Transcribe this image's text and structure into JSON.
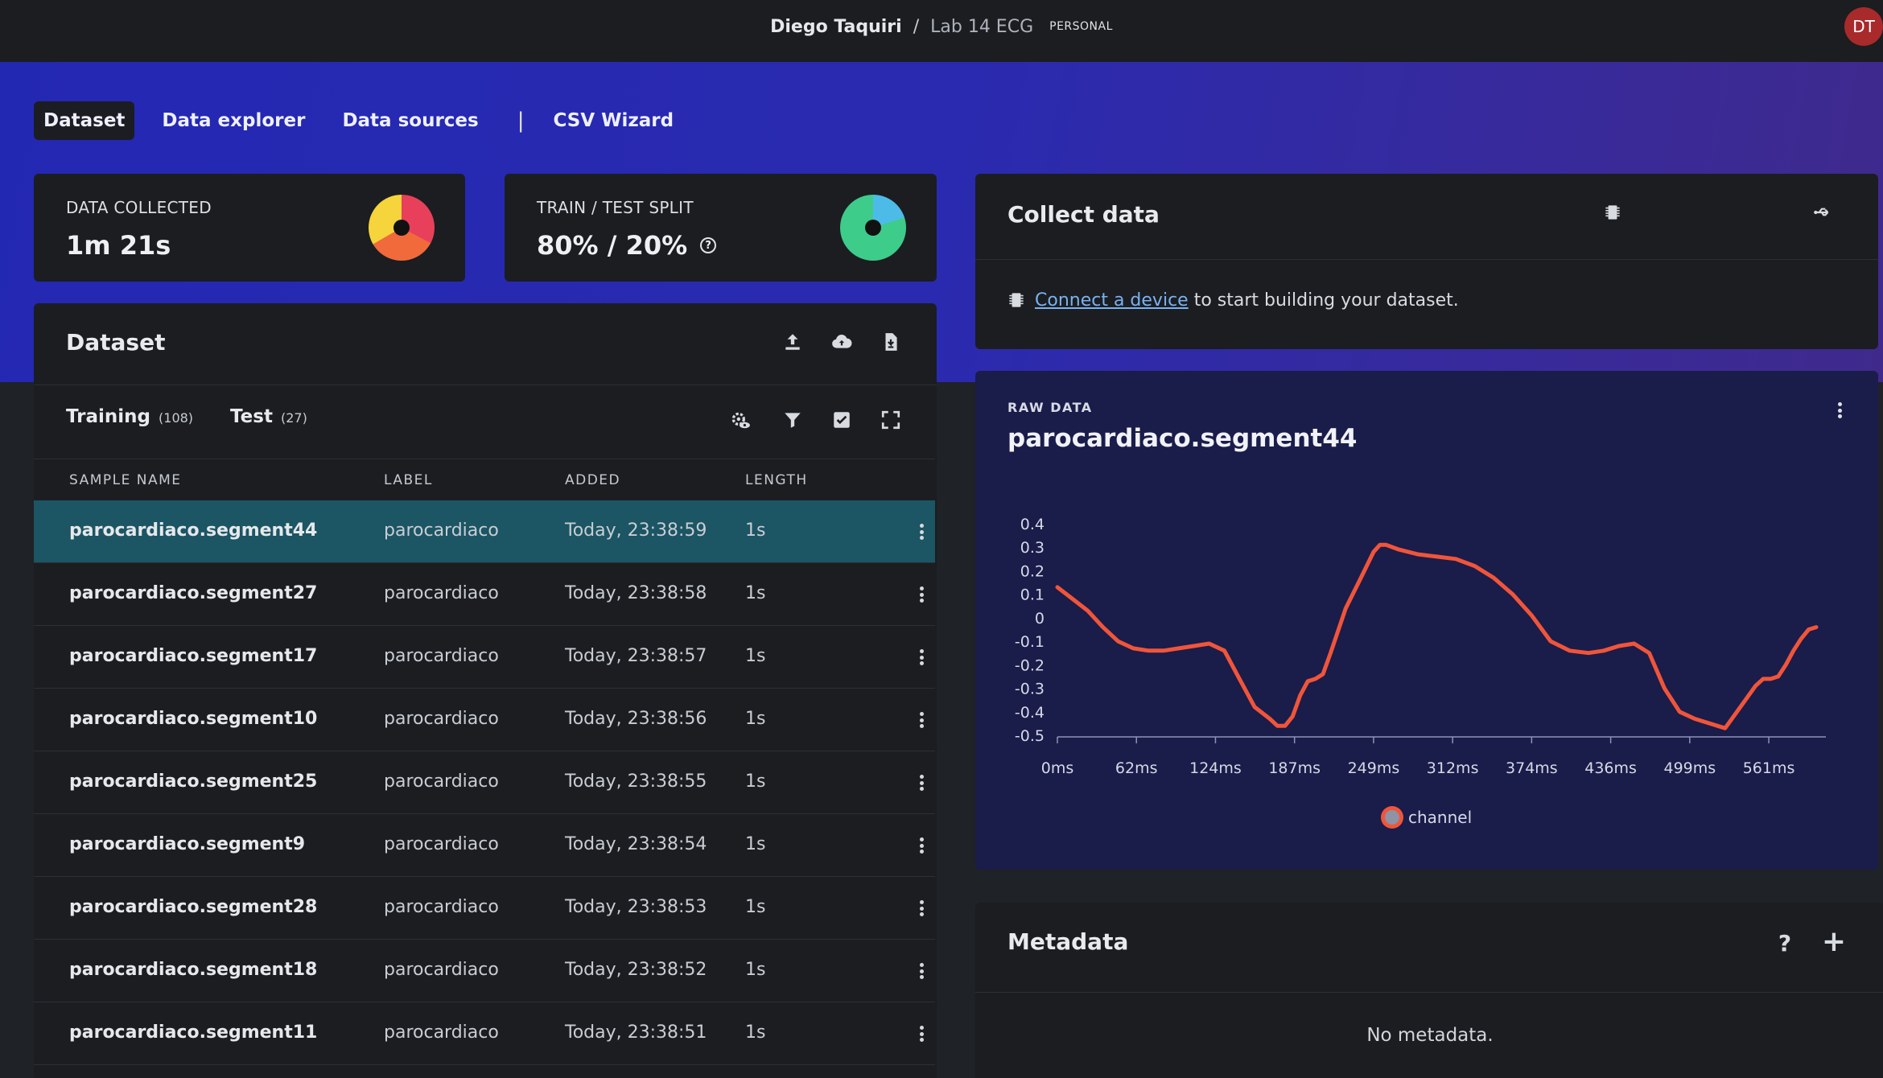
{
  "header": {
    "org": "Diego Taquiri",
    "separator": "/",
    "project": "Lab 14 ECG",
    "tag": "PERSONAL",
    "avatar_initials": "DT"
  },
  "nav": {
    "tabs": [
      {
        "label": "Dataset",
        "active": true
      },
      {
        "label": "Data explorer",
        "active": false
      },
      {
        "label": "Data sources",
        "active": false
      }
    ],
    "divider": "|",
    "wizard_label": "CSV Wizard"
  },
  "stats": {
    "collected_label": "DATA COLLECTED",
    "collected_value": "1m 21s",
    "split_label": "TRAIN / TEST SPLIT",
    "split_value": "80% / 20%",
    "split_help": "?"
  },
  "dataset": {
    "title": "Dataset",
    "training_label": "Training",
    "training_count": "(108)",
    "test_label": "Test",
    "test_count": "(27)",
    "columns": [
      "SAMPLE NAME",
      "LABEL",
      "ADDED",
      "LENGTH"
    ],
    "rows": [
      {
        "name": "parocardiaco.segment44",
        "label": "parocardiaco",
        "added": "Today, 23:38:59",
        "length": "1s",
        "selected": true
      },
      {
        "name": "parocardiaco.segment27",
        "label": "parocardiaco",
        "added": "Today, 23:38:58",
        "length": "1s"
      },
      {
        "name": "parocardiaco.segment17",
        "label": "parocardiaco",
        "added": "Today, 23:38:57",
        "length": "1s"
      },
      {
        "name": "parocardiaco.segment10",
        "label": "parocardiaco",
        "added": "Today, 23:38:56",
        "length": "1s"
      },
      {
        "name": "parocardiaco.segment25",
        "label": "parocardiaco",
        "added": "Today, 23:38:55",
        "length": "1s"
      },
      {
        "name": "parocardiaco.segment9",
        "label": "parocardiaco",
        "added": "Today, 23:38:54",
        "length": "1s"
      },
      {
        "name": "parocardiaco.segment28",
        "label": "parocardiaco",
        "added": "Today, 23:38:53",
        "length": "1s"
      },
      {
        "name": "parocardiaco.segment18",
        "label": "parocardiaco",
        "added": "Today, 23:38:52",
        "length": "1s"
      },
      {
        "name": "parocardiaco.segment11",
        "label": "parocardiaco",
        "added": "Today, 23:38:51",
        "length": "1s"
      }
    ]
  },
  "collect": {
    "title": "Collect data",
    "link_text": "Connect a device",
    "rest_text": " to start building your dataset."
  },
  "raw": {
    "label": "RAW DATA",
    "title": "parocardiaco.segment44"
  },
  "metadata": {
    "title": "Metadata",
    "help": "?",
    "add": "+",
    "empty_text": "No metadata."
  },
  "colors": {
    "hero_start": "#2328b2",
    "hero_end": "#3f2a8c",
    "selected_row": "#1c5564",
    "series_line": "#f0553a",
    "link": "#7ab2f0"
  },
  "chart_data": {
    "type": "line",
    "title": "",
    "xlabel": "",
    "ylabel": "",
    "ylim": [
      -0.5,
      0.4
    ],
    "xlim": [
      0,
      600
    ],
    "y_ticks": [
      "0.4",
      "0.3",
      "0.2",
      "0.1",
      "0",
      "-0.1",
      "-0.2",
      "-0.3",
      "-0.4",
      "-0.5"
    ],
    "x_ticks": [
      "0ms",
      "62ms",
      "124ms",
      "187ms",
      "249ms",
      "312ms",
      "374ms",
      "436ms",
      "499ms",
      "561ms"
    ],
    "legend": "bottom-center",
    "series": [
      {
        "name": "channel",
        "color": "#f0553a",
        "x": [
          0,
          12,
          24,
          36,
          48,
          60,
          72,
          84,
          96,
          108,
          120,
          132,
          144,
          156,
          168,
          174,
          180,
          186,
          192,
          198,
          204,
          210,
          216,
          228,
          240,
          250,
          255,
          260,
          270,
          285,
          300,
          315,
          330,
          345,
          360,
          375,
          390,
          405,
          420,
          432,
          444,
          456,
          468,
          480,
          492,
          504,
          516,
          528,
          540,
          552,
          558,
          564,
          570,
          576,
          582,
          588,
          594,
          600
        ],
        "y": [
          0.13,
          0.08,
          0.03,
          -0.04,
          -0.1,
          -0.13,
          -0.14,
          -0.14,
          -0.13,
          -0.12,
          -0.11,
          -0.14,
          -0.26,
          -0.38,
          -0.43,
          -0.46,
          -0.46,
          -0.42,
          -0.33,
          -0.27,
          -0.26,
          -0.24,
          -0.15,
          0.04,
          0.17,
          0.28,
          0.31,
          0.31,
          0.29,
          0.27,
          0.26,
          0.25,
          0.22,
          0.17,
          0.1,
          0.01,
          -0.1,
          -0.14,
          -0.15,
          -0.14,
          -0.12,
          -0.11,
          -0.15,
          -0.3,
          -0.4,
          -0.43,
          -0.45,
          -0.47,
          -0.38,
          -0.29,
          -0.26,
          -0.26,
          -0.25,
          -0.2,
          -0.14,
          -0.09,
          -0.05,
          -0.04
        ]
      }
    ]
  }
}
